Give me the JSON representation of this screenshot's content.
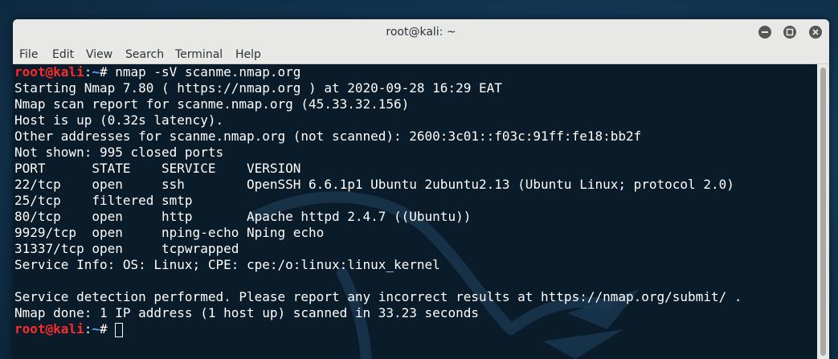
{
  "window": {
    "title": "root@kali: ~"
  },
  "menu": [
    "File",
    "Edit",
    "View",
    "Search",
    "Terminal",
    "Help"
  ],
  "prompt": {
    "user": "root@kali",
    "colon": ":",
    "path": "~",
    "symbol": "# "
  },
  "command": "nmap -sV scanme.nmap.org",
  "output": [
    "Starting Nmap 7.80 ( https://nmap.org ) at 2020-09-28 16:29 EAT",
    "Nmap scan report for scanme.nmap.org (45.33.32.156)",
    "Host is up (0.32s latency).",
    "Other addresses for scanme.nmap.org (not scanned): 2600:3c01::f03c:91ff:fe18:bb2f",
    "Not shown: 995 closed ports",
    "PORT      STATE    SERVICE    VERSION",
    "22/tcp    open     ssh        OpenSSH 6.6.1p1 Ubuntu 2ubuntu2.13 (Ubuntu Linux; protocol 2.0)",
    "25/tcp    filtered smtp",
    "80/tcp    open     http       Apache httpd 2.4.7 ((Ubuntu))",
    "9929/tcp  open     nping-echo Nping echo",
    "31337/tcp open     tcpwrapped",
    "Service Info: OS: Linux; CPE: cpe:/o:linux:linux_kernel",
    "",
    "Service detection performed. Please report any incorrect results at https://nmap.org/submit/ .",
    "Nmap done: 1 IP address (1 host up) scanned in 33.23 seconds"
  ],
  "colors": {
    "prompt_user": "#ff2b2b",
    "prompt_path": "#5c9dff",
    "terminal_bg": "#0a1b2a",
    "text": "#ffffff"
  },
  "icons": {
    "minimize": "minimize-icon",
    "maximize": "maximize-icon",
    "close": "close-icon"
  }
}
